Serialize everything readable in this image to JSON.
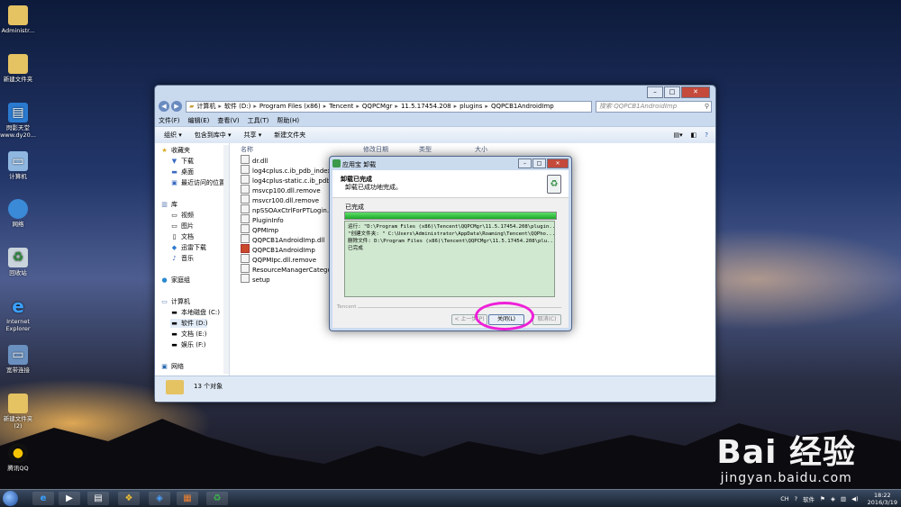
{
  "desktop": {
    "icons": [
      {
        "label": "Administr...",
        "icon": "folder-icon"
      },
      {
        "label": "新建文件夹",
        "icon": "folder-icon"
      },
      {
        "label": "閃影天堂",
        "label2": "www.dy20...",
        "icon": "shortcut-icon"
      },
      {
        "label": "计算机",
        "icon": "computer-icon"
      },
      {
        "label": "网络",
        "icon": "network-icon"
      },
      {
        "label": "回收站",
        "icon": "recycle-bin-icon"
      },
      {
        "label": "Internet",
        "label2": "Explorer",
        "icon": "ie-icon"
      },
      {
        "label": "宽带连接",
        "icon": "broadband-icon"
      },
      {
        "label": "新建文件夹",
        "label2": "(2)",
        "icon": "folder-icon"
      },
      {
        "label": "腾讯QQ",
        "icon": "qq-icon"
      }
    ]
  },
  "explorer": {
    "breadcrumb": [
      "计算机",
      "软件 (D:)",
      "Program Files (x86)",
      "Tencent",
      "QQPCMgr",
      "11.5.17454.208",
      "plugins",
      "QQPCB1AndroidImp"
    ],
    "search_placeholder": "搜索 QQPCB1AndroidImp",
    "menu": [
      "文件(F)",
      "编辑(E)",
      "查看(V)",
      "工具(T)",
      "帮助(H)"
    ],
    "commands": [
      "组织 ▾",
      "包含到库中 ▾",
      "共享 ▾",
      "新建文件夹"
    ],
    "columns": [
      "名称",
      "修改日期",
      "类型",
      "大小"
    ],
    "nav": {
      "favorites_title": "收藏夹",
      "favorites": [
        "下载",
        "桌面",
        "最近访问的位置"
      ],
      "libraries_title": "库",
      "libraries": [
        "视频",
        "图片",
        "文档",
        "迅雷下载",
        "音乐"
      ],
      "homegroup": "家庭组",
      "computer_title": "计算机",
      "drives": [
        "本地磁盘 (C:)",
        "软件 (D:)",
        "文档 (E:)",
        "娱乐 (F:)"
      ],
      "network": "网络"
    },
    "files": [
      "dr.dll",
      "log4cplus.c.ib_pdb_index",
      "log4cplus-static.c.ib_pdb_index",
      "msvcp100.dll.remove",
      "msvcr100.dll.remove",
      "npSSOAxCtrlForPTLogin.dll",
      "PluginInfo",
      "QPMImp",
      "QQPCB1AndroidImp.dll",
      "QQPCB1AndroidImp",
      "QQPMIpc.dll.remove",
      "ResourceManagerCategory_V",
      "setup"
    ],
    "status_count": "13 个对象"
  },
  "dialog": {
    "title": "应用宝 卸载",
    "header_title": "卸载已完成",
    "header_sub": "卸载已成功地完成。",
    "status": "已完成",
    "progress": 1.0,
    "log": [
      "运行: \"D:\\Program Files (x86)\\Tencent\\QQPCMgr\\11.5.17454.208\\plugin...",
      "\"创建文件夹: \" C:\\Users\\Administrator\\AppData\\Roaming\\Tencent\\QQPho...",
      "删除文件: D:\\Program Files (x86)\\Tencent\\QQPCMgr\\11.5.17454.208\\plu...",
      "已完成"
    ],
    "brand": "Tencent",
    "btn_back": "< 上一步(P)",
    "btn_close": "关闭(L)",
    "btn_cancel": "取消(C)"
  },
  "taskbar": {
    "tray_lang": "CH",
    "tray_label": "软件",
    "time": "18:22",
    "date": "2016/3/19"
  },
  "watermark": {
    "brand": "Bai 经验",
    "url": "jingyan.baidu.com"
  },
  "colors": {
    "highlight": "#ee20d8",
    "progress": "#1da82b"
  }
}
